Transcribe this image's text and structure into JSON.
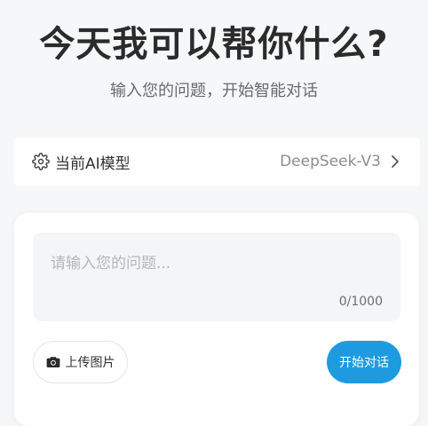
{
  "header": {
    "title": "今天我可以帮你什么?",
    "subtitle": "输入您的问题，开始智能对话"
  },
  "model_selector": {
    "label": "当前AI模型",
    "value": "DeepSeek-V3",
    "icon": "gear-icon"
  },
  "composer": {
    "placeholder": "请输入您的问题...",
    "value": "",
    "counter": "0/1000"
  },
  "actions": {
    "upload_label": "上传图片",
    "upload_icon": "camera-icon",
    "start_label": "开始对话"
  },
  "colors": {
    "accent": "#1e9be0",
    "background": "#f6f7f9"
  }
}
